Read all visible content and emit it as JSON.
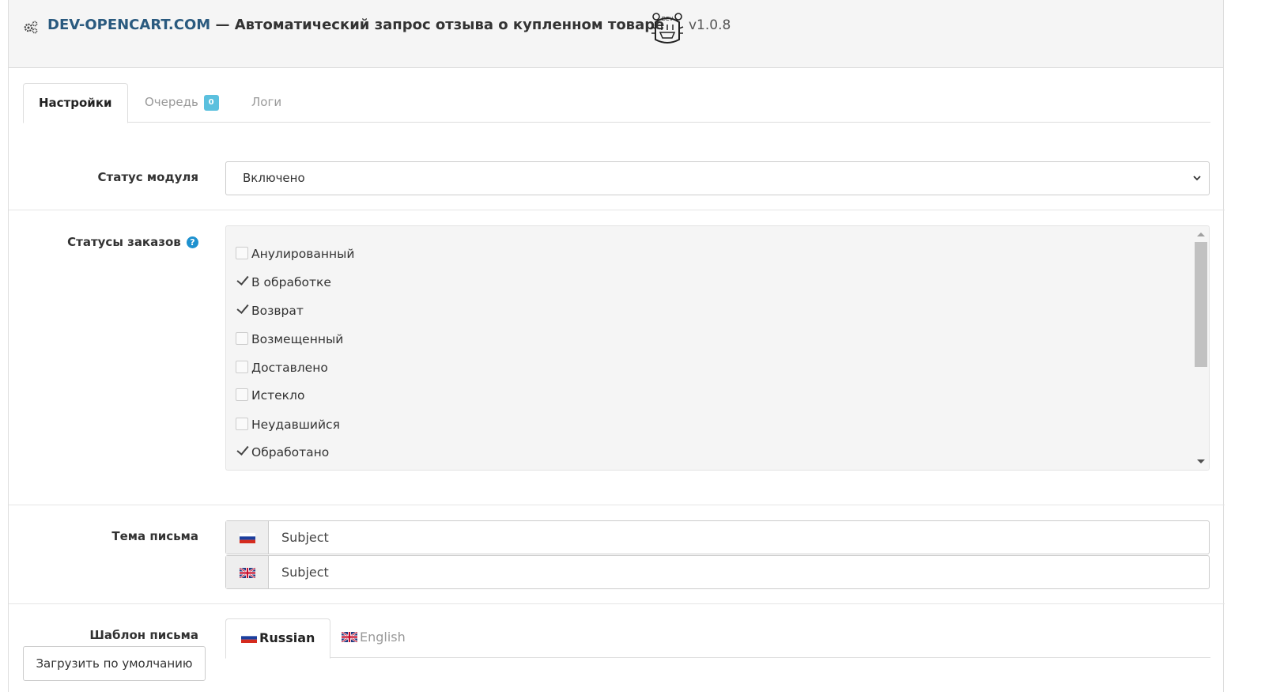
{
  "header": {
    "brand": "DEV-OPENCART.COM",
    "title_rest": " — Автоматический запрос отзыва о купленном товаре",
    "version": "v1.0.8",
    "logo_text": "DEV"
  },
  "tabs": [
    {
      "label": "Настройки",
      "active": true
    },
    {
      "label": "Очередь",
      "badge": "0",
      "active": false
    },
    {
      "label": "Логи",
      "active": false
    }
  ],
  "module_status": {
    "label": "Статус модуля",
    "selected": "Включено"
  },
  "order_statuses": {
    "label": "Статусы заказов",
    "help_icon": "?",
    "items": [
      {
        "label": "Анулированный",
        "checked": false
      },
      {
        "label": "В обработке",
        "checked": true
      },
      {
        "label": "Возврат",
        "checked": true
      },
      {
        "label": "Возмещенный",
        "checked": false
      },
      {
        "label": "Доставлено",
        "checked": false
      },
      {
        "label": "Истекло",
        "checked": false
      },
      {
        "label": "Неудавшийся",
        "checked": false
      },
      {
        "label": "Обработано",
        "checked": true
      }
    ]
  },
  "email_subject": {
    "label": "Тема письма",
    "fields": [
      {
        "language": "russian-flag-icon",
        "value": "Subject"
      },
      {
        "language": "english-flag-icon",
        "value": "Subject"
      }
    ]
  },
  "email_template": {
    "label": "Шаблон письма",
    "load_default_button": "Загрузить по умолчанию",
    "tabs": [
      {
        "label": "Russian",
        "active": true
      },
      {
        "label": "English",
        "active": false
      }
    ]
  },
  "colors": {
    "accent": "#1e91cf",
    "badge": "#5bc0de",
    "brand": "#2a5a7f"
  }
}
